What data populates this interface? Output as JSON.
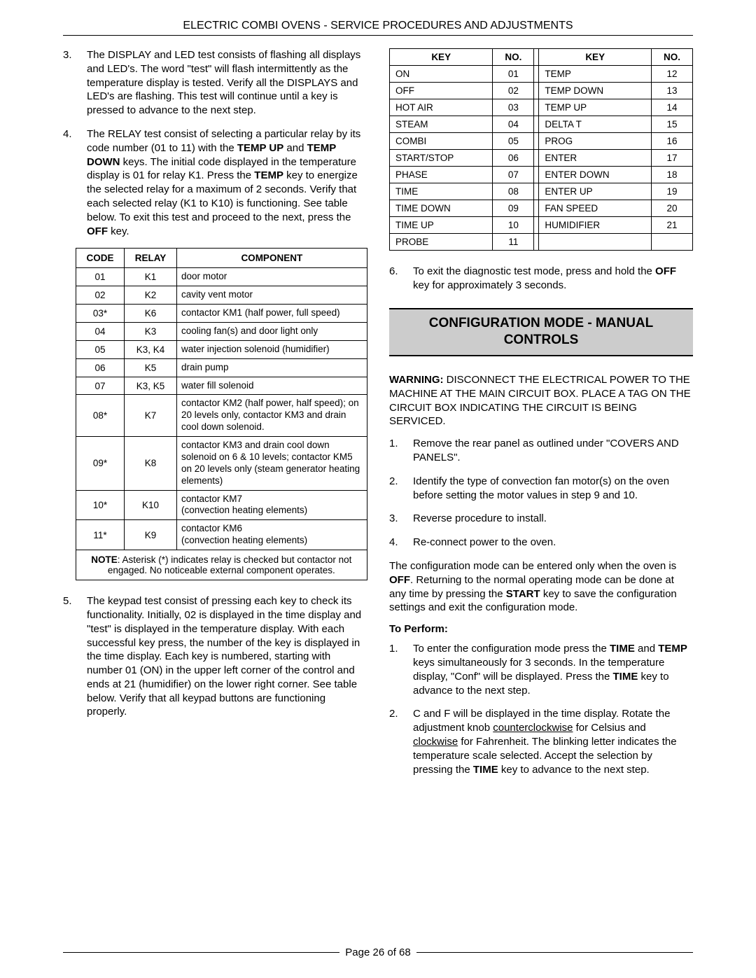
{
  "header": "ELECTRIC COMBI OVENS - SERVICE PROCEDURES AND ADJUSTMENTS",
  "left": {
    "item3": {
      "num": "3.",
      "text": "The DISPLAY and LED test consists of flashing all displays and LED's. The word \"test\" will flash intermittently as the temperature display is tested. Verify all the DISPLAYS and LED's are flashing. This test will continue until a key is pressed to advance to the next step."
    },
    "item4": {
      "num": "4.",
      "text_a": "The RELAY test consist of selecting a particular relay by its code number (01 to 11) with the ",
      "b1": "TEMP UP",
      "mid1": " and ",
      "b2": "TEMP DOWN",
      "mid2": " keys. The initial code displayed in the temperature display is 01 for relay K1. Press the ",
      "b3": "TEMP",
      "mid3": " key to energize the selected relay for a maximum of 2 seconds. Verify that each selected relay (K1 to K10) is functioning. See table below. To exit this test and proceed to the next, press the ",
      "b4": "OFF",
      "text_b": " key."
    },
    "relay_headers": {
      "code": "CODE",
      "relay": "RELAY",
      "component": "COMPONENT"
    },
    "relay_rows": [
      {
        "code": "01",
        "relay": "K1",
        "comp": "door motor"
      },
      {
        "code": "02",
        "relay": "K2",
        "comp": "cavity vent motor"
      },
      {
        "code": "03*",
        "relay": "K6",
        "comp": "contactor KM1 (half power, full speed)"
      },
      {
        "code": "04",
        "relay": "K3",
        "comp": "cooling fan(s) and door light only"
      },
      {
        "code": "05",
        "relay": "K3, K4",
        "comp": "water injection solenoid (humidifier)"
      },
      {
        "code": "06",
        "relay": "K5",
        "comp": "drain pump"
      },
      {
        "code": "07",
        "relay": "K3, K5",
        "comp": "water fill solenoid"
      },
      {
        "code": "08*",
        "relay": "K7",
        "comp": "contactor KM2 (half power, half speed); on 20 levels only, contactor KM3 and drain cool down solenoid."
      },
      {
        "code": "09*",
        "relay": "K8",
        "comp": "contactor KM3 and drain cool down solenoid on 6 & 10 levels; contactor KM5 on 20 levels only (steam generator heating elements)"
      },
      {
        "code": "10*",
        "relay": "K10",
        "comp": "contactor KM7\n(convection heating elements)"
      },
      {
        "code": "11*",
        "relay": "K9",
        "comp": "contactor KM6\n(convection heating elements)"
      }
    ],
    "relay_note_b": "NOTE",
    "relay_note": ": Asterisk (*) indicates relay is checked but contactor not engaged. No noticeable external component operates.",
    "item5": {
      "num": "5.",
      "text": "The keypad test consist of pressing each key to check its functionality. Initially, 02 is displayed in the time display and \"test\" is displayed in the temperature display. With each successful key press, the number of the key is  displayed in the time display. Each key is numbered, starting with number 01 (ON) in the upper left corner of the control and ends at 21 (humidifier) on the lower right corner. See table below. Verify that all keypad buttons are functioning properly."
    }
  },
  "right": {
    "key_headers": {
      "key": "KEY",
      "no": "NO."
    },
    "key_rows": [
      {
        "k1": "ON",
        "n1": "01",
        "k2": "TEMP",
        "n2": "12"
      },
      {
        "k1": "OFF",
        "n1": "02",
        "k2": "TEMP DOWN",
        "n2": "13"
      },
      {
        "k1": "HOT AIR",
        "n1": "03",
        "k2": "TEMP UP",
        "n2": "14"
      },
      {
        "k1": "STEAM",
        "n1": "04",
        "k2": "DELTA T",
        "n2": "15"
      },
      {
        "k1": "COMBI",
        "n1": "05",
        "k2": "PROG",
        "n2": "16"
      },
      {
        "k1": "START/STOP",
        "n1": "06",
        "k2": "ENTER",
        "n2": "17"
      },
      {
        "k1": "PHASE",
        "n1": "07",
        "k2": "ENTER DOWN",
        "n2": "18"
      },
      {
        "k1": "TIME",
        "n1": "08",
        "k2": "ENTER UP",
        "n2": "19"
      },
      {
        "k1": "TIME DOWN",
        "n1": "09",
        "k2": "FAN SPEED",
        "n2": "20"
      },
      {
        "k1": "TIME UP",
        "n1": "10",
        "k2": "HUMIDIFIER",
        "n2": "21"
      },
      {
        "k1": "PROBE",
        "n1": "11",
        "k2": "",
        "n2": ""
      }
    ],
    "item6": {
      "num": "6.",
      "text_a": "To exit the diagnostic test mode, press and hold the ",
      "b1": "OFF",
      "text_b": " key for approximately 3 seconds."
    },
    "section_title": "CONFIGURATION MODE - MANUAL CONTROLS",
    "warning_b": "WARNING:",
    "warning": " DISCONNECT THE ELECTRICAL POWER TO THE MACHINE AT THE MAIN CIRCUIT BOX. PLACE A TAG ON THE CIRCUIT BOX INDICATING THE CIRCUIT IS BEING SERVICED.",
    "s1": {
      "num": "1.",
      "text": "Remove the rear panel as outlined under \"COVERS AND PANELS\"."
    },
    "s2": {
      "num": "2.",
      "text": "Identify the type of convection fan motor(s) on the oven before setting the motor values in step 9 and 10."
    },
    "s3": {
      "num": "3.",
      "text": "Reverse procedure to install."
    },
    "s4": {
      "num": "4.",
      "text": "Re-connect power to the oven."
    },
    "cfg_para_a": "The configuration mode can be entered only when the oven is ",
    "cfg_b1": "OFF",
    "cfg_para_b": ". Returning to the normal operating mode can be done at any time by pressing the ",
    "cfg_b2": "START",
    "cfg_para_c": " key to save the configuration settings and exit the configuration mode.",
    "to_perform": "To Perform:",
    "p1": {
      "num": "1.",
      "a": "To enter the configuration mode press the ",
      "b1": "TIME",
      "m1": " and ",
      "b2": "TEMP",
      "m2": " keys simultaneously for 3 seconds. In the temperature display, \"Conf\" will be displayed. Press the ",
      "b3": "TIME",
      "e": " key to advance to the next step."
    },
    "p2": {
      "num": "2.",
      "a": "C and F will be displayed in the time display. Rotate the adjustment knob ",
      "u1": "counterclockwise",
      "m1": " for Celsius and ",
      "u2": "clockwise",
      "m2": " for Fahrenheit. The blinking letter indicates the temperature scale selected. Accept the selection by pressing the ",
      "b1": "TIME",
      "e": " key to advance to the next step."
    }
  },
  "footer": {
    "page_a": "Page 26 of",
    "page_b": "  68"
  }
}
